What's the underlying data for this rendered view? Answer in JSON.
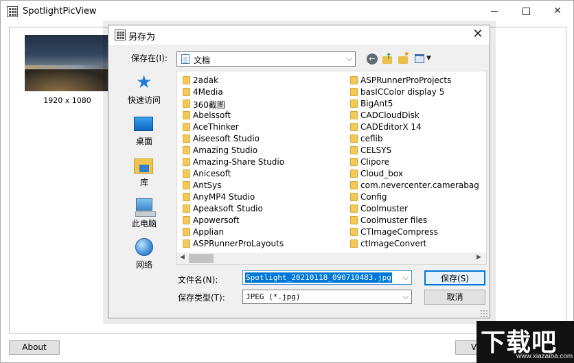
{
  "app": {
    "title": "SpotlightPicView",
    "thumbnail_caption": "1920 x 1080",
    "about_label": "About",
    "view_label": "Vie",
    "window_buttons": {
      "minimize": "",
      "maximize": "",
      "close": "✕"
    }
  },
  "watermark": {
    "main": "下载吧",
    "url": "www.xiazaiba.com"
  },
  "dialog": {
    "title": "另存为",
    "close_glyph": "✕",
    "save_in_label": "保存在(I):",
    "save_in_value": "文档",
    "combo_arrow": "⌵",
    "back_glyph": "←",
    "up_glyph": "↑",
    "new_folder_glyph": "✷",
    "view_drop_glyph": "▼",
    "places": [
      {
        "label": "快速访问",
        "icon": "star-icon"
      },
      {
        "label": "桌面",
        "icon": "desktop-icon"
      },
      {
        "label": "库",
        "icon": "library-icon"
      },
      {
        "label": "此电脑",
        "icon": "computer-icon"
      },
      {
        "label": "网络",
        "icon": "network-icon"
      }
    ],
    "folders_col1": [
      "2adak",
      "4Media",
      "360截图",
      "Abelssoft",
      "AceThinker",
      "Aiseesoft Studio",
      "Amazing Studio",
      "Amazing-Share Studio",
      "Anicesoft",
      "AntSys",
      "AnyMP4 Studio",
      "Apeaksoft Studio",
      "Apowersoft",
      "Applian",
      "ASPRunnerProLayouts"
    ],
    "folders_col2": [
      "ASPRunnerProProjects",
      "basICColor display 5",
      "BigAnt5",
      "CADCloudDisk",
      "CADEditorX 14",
      "ceflib",
      "CELSYS",
      "Clipore",
      "Cloud_box",
      "com.nevercenter.camerabag",
      "Config",
      "Coolmuster",
      "Coolmuster files",
      "CTImageCompress",
      "ctImageConvert"
    ],
    "scroll_left": "◀",
    "scroll_right": "▶",
    "filename_label": "文件名(N):",
    "filename_value": "Spotlight_20210118_090710483.jpg",
    "filetype_label": "保存类型(T):",
    "filetype_value": "JPEG (*.jpg)",
    "save_label": "保存(S)",
    "cancel_label": "取消"
  }
}
